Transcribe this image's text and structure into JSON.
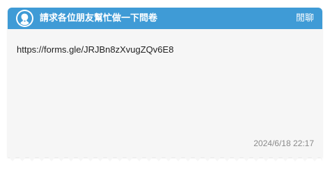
{
  "header": {
    "title": "請求各位朋友幫忙做一下問卷",
    "chat_button_label": "閒聊",
    "avatar_icon": "user-silhouette-icon",
    "background_color": "#3f9bd6"
  },
  "message": {
    "text": "https://forms.gle/JRJBn8zXvugZQv6E8",
    "timestamp": "2024/6/18 22:17"
  }
}
